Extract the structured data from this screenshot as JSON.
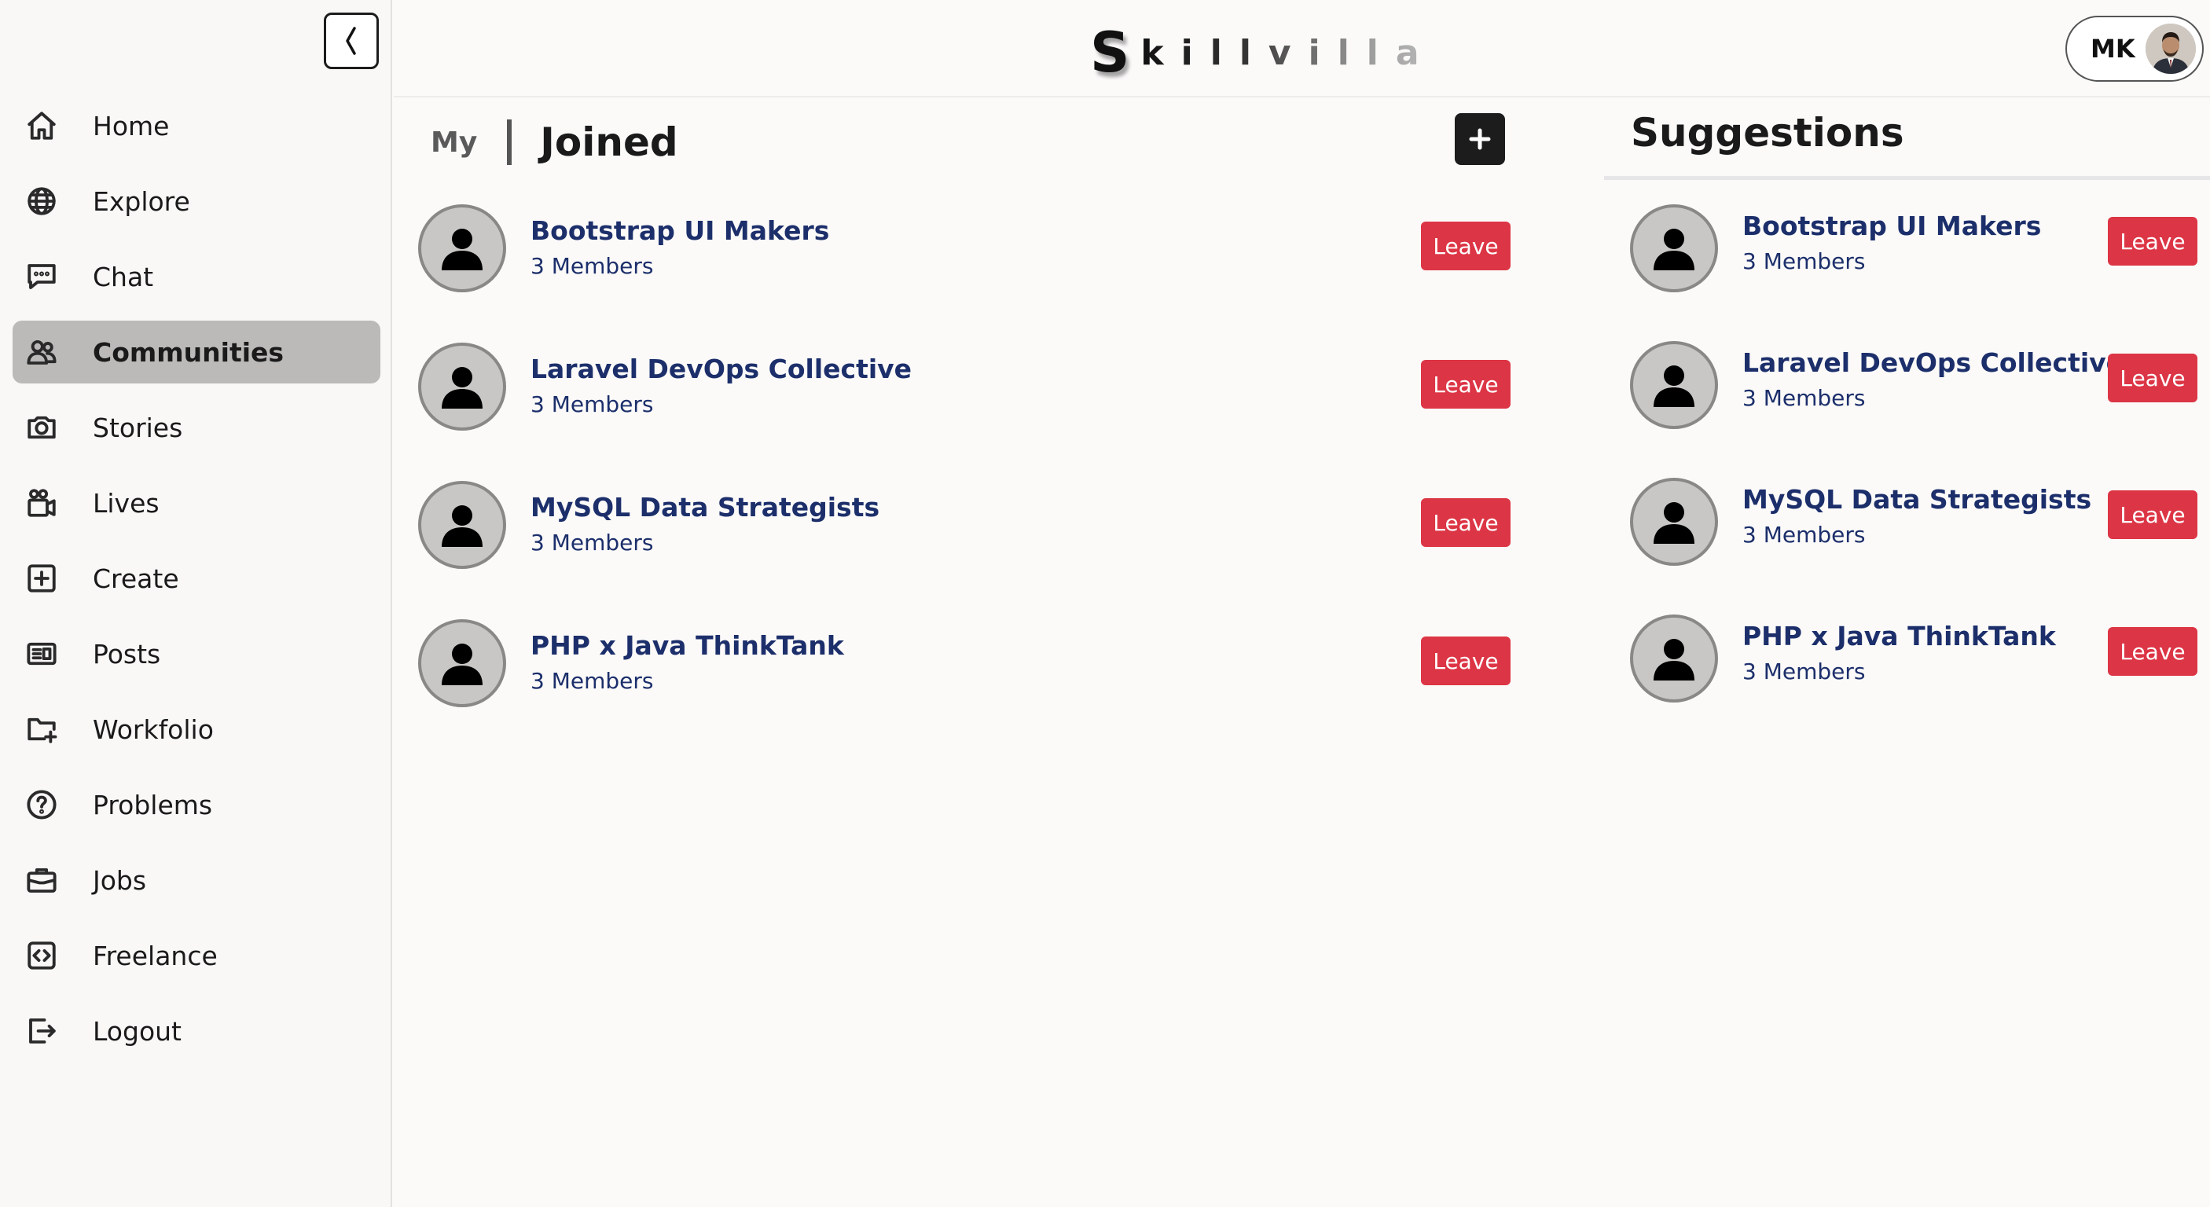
{
  "brand": {
    "first": "S",
    "rest": "killvilla"
  },
  "profile": {
    "initials": "MK"
  },
  "sidebar": {
    "items": [
      {
        "label": "Home",
        "icon": "home-icon"
      },
      {
        "label": "Explore",
        "icon": "globe-icon"
      },
      {
        "label": "Chat",
        "icon": "chat-icon"
      },
      {
        "label": "Communities",
        "icon": "people-icon",
        "active": true
      },
      {
        "label": "Stories",
        "icon": "camera-icon"
      },
      {
        "label": "Lives",
        "icon": "video-camera-icon"
      },
      {
        "label": "Create",
        "icon": "plus-square-icon"
      },
      {
        "label": "Posts",
        "icon": "newspaper-icon"
      },
      {
        "label": "Workfolio",
        "icon": "folder-plus-icon"
      },
      {
        "label": "Problems",
        "icon": "question-circle-icon"
      },
      {
        "label": "Jobs",
        "icon": "briefcase-icon"
      },
      {
        "label": "Freelance",
        "icon": "code-square-icon"
      },
      {
        "label": "Logout",
        "icon": "logout-icon"
      }
    ]
  },
  "main": {
    "tab_my": "My",
    "tab_joined": "Joined",
    "communities": [
      {
        "name": "Bootstrap UI Makers",
        "members": "3 Members",
        "action": "Leave"
      },
      {
        "name": "Laravel DevOps Collective",
        "members": "3 Members",
        "action": "Leave"
      },
      {
        "name": "MySQL Data Strategists",
        "members": "3 Members",
        "action": "Leave"
      },
      {
        "name": "PHP x Java ThinkTank",
        "members": "3 Members",
        "action": "Leave"
      }
    ]
  },
  "suggestions": {
    "title": "Suggestions",
    "items": [
      {
        "name": "Bootstrap UI Makers",
        "members": "3 Members",
        "action": "Leave"
      },
      {
        "name": "Laravel DevOps Collective",
        "members": "3 Members",
        "action": "Leave"
      },
      {
        "name": "MySQL Data Strategists",
        "members": "3 Members",
        "action": "Leave"
      },
      {
        "name": "PHP x Java ThinkTank",
        "members": "3 Members",
        "action": "Leave"
      }
    ]
  },
  "colors": {
    "leave": "#dc3545",
    "link": "#1c2f6b",
    "active_nav": "#bcbab8"
  }
}
